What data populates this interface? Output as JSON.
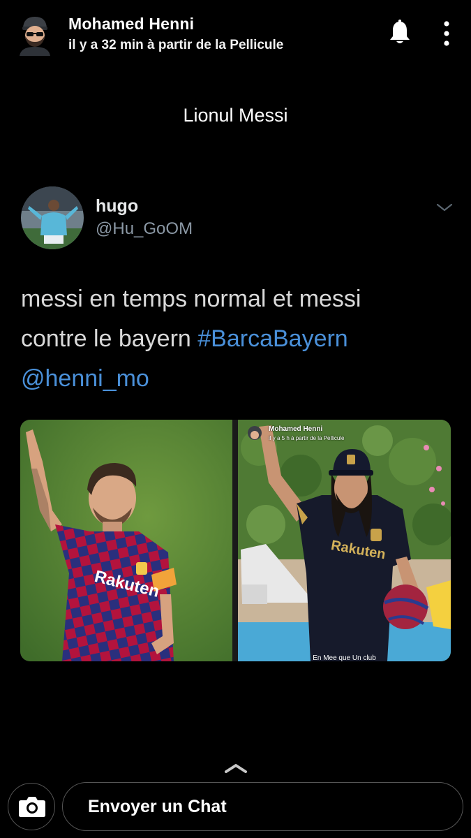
{
  "snap": {
    "sender_name": "Mohamed Henni",
    "subtitle": "il y a 32 min à partir de la Pellicule",
    "caption": "Lionul Messi",
    "icons": {
      "avatar": "bitmoji-avatar-icon",
      "notification": "bell-icon",
      "menu": "more-vertical-icon"
    }
  },
  "tweet": {
    "display_name": "hugo",
    "handle": "@Hu_GoOM",
    "text_line1": "messi en temps normal et messi",
    "text_line2_plain": "contre le bayern ",
    "hashtag": "#BarcaBayern",
    "mention": "@henni_mo",
    "link_color": "#4a90d9",
    "media": {
      "left_photo": {
        "jersey_text": "Rakuten"
      },
      "right_photo": {
        "overlay_name": "Mohamed Henni",
        "overlay_subtitle": "il y a 5 h à partir de la Pellicule",
        "jersey_text": "Rakuten",
        "bottom_caption": "En Mee que Un club"
      }
    }
  },
  "bottom_bar": {
    "chat_placeholder": "Envoyer un Chat",
    "icons": {
      "swipe_up": "chevron-up-icon",
      "camera": "camera-icon"
    }
  }
}
